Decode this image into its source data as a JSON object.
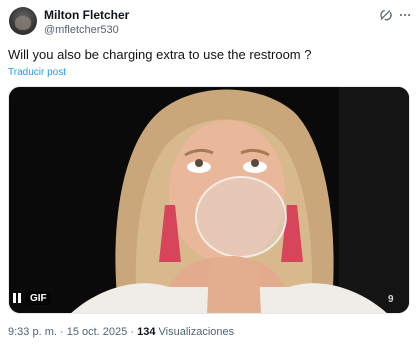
{
  "author": {
    "name": "Milton Fletcher",
    "handle": "@mfletcher530"
  },
  "post": {
    "text": "Will you also be charging extra to use the restroom ?",
    "translate_label": "Traducir post"
  },
  "media": {
    "badge": "GIF",
    "channel_logo": "9",
    "controls": [
      "pause-icon"
    ]
  },
  "meta": {
    "time": "9:33 p. m.",
    "separator": "·",
    "date": "15 oct. 2025",
    "views_count": "134",
    "views_label": "Visualizaciones"
  },
  "icons": [
    "grok-icon",
    "more-icon"
  ],
  "colors": {
    "link": "#1d9bf0",
    "secondary_text": "#536471",
    "primary_text": "#0f1419"
  }
}
